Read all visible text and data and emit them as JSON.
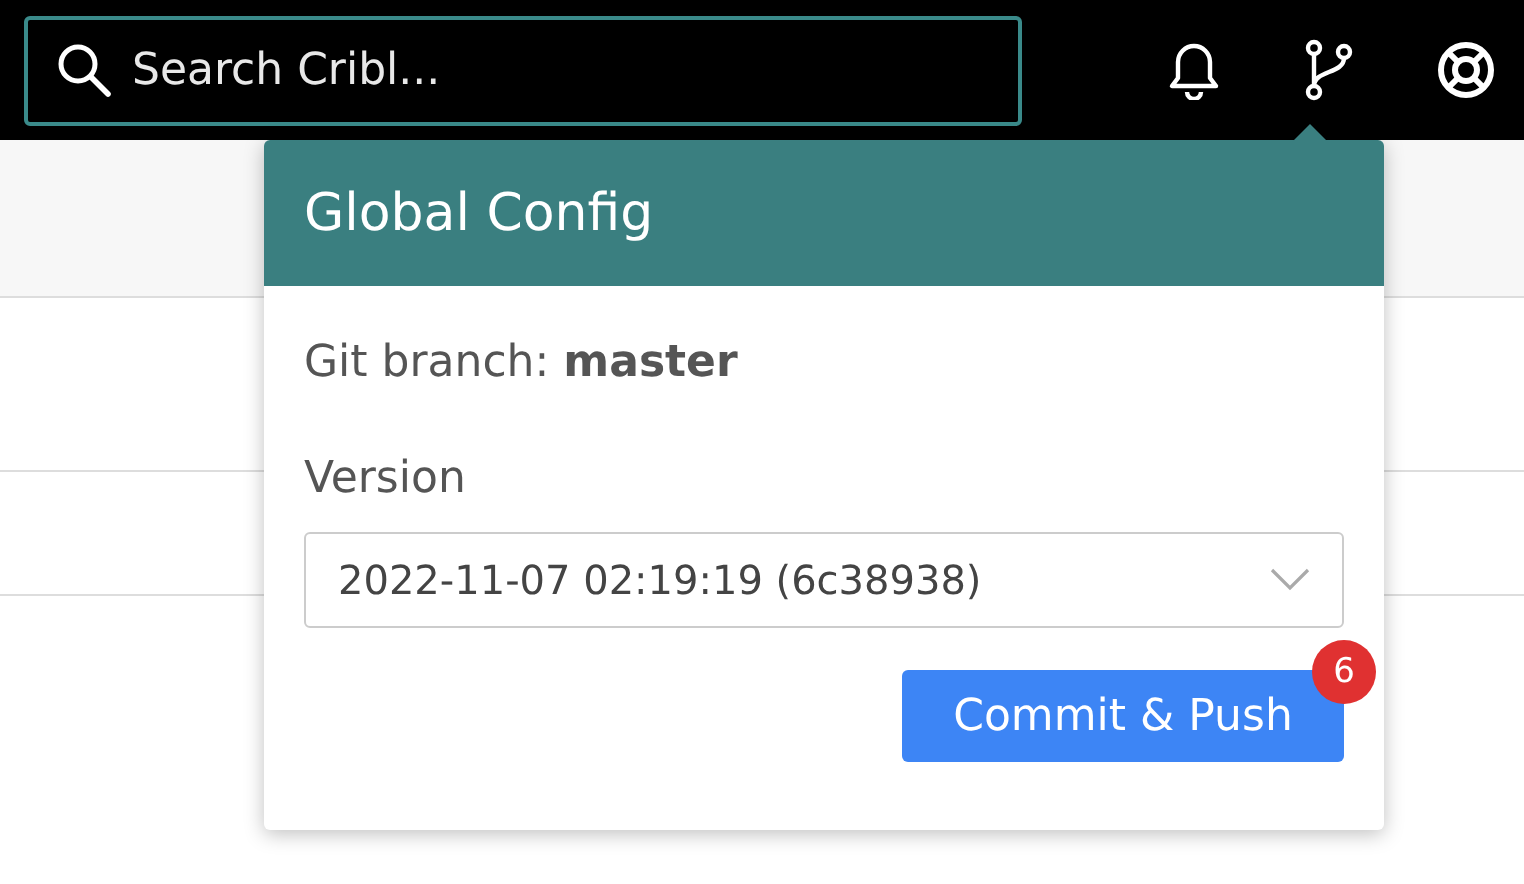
{
  "search": {
    "placeholder": "Search Cribl..."
  },
  "popover": {
    "title": "Global Config",
    "branch": "Git branch: **master**",
    "version_label": "Version",
    "version": {
      "value": "2022-11-07 02:19:19 (6c38938)"
    },
    "commit_button": {
      "label": "Commit & Push",
      "badge": "6"
    }
  }
}
